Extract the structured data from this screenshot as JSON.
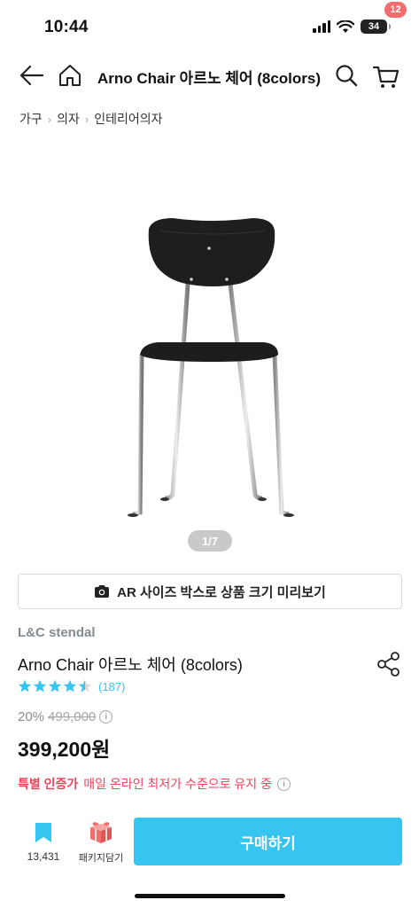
{
  "status_bar": {
    "time": "10:44",
    "battery": "34"
  },
  "header": {
    "title": "Arno Chair 아르노 체어 (8colors)",
    "cart_count": "12"
  },
  "breadcrumb": [
    "가구",
    "의자",
    "인테리어의자"
  ],
  "image": {
    "pager": "1/7"
  },
  "ar_button": {
    "label": "AR 사이즈 박스로 상품 크기 미리보기"
  },
  "product": {
    "brand": "L&C stendal",
    "name": "Arno Chair 아르노 체어 (8colors)",
    "rating_stars": 4.5,
    "review_count": "(187)",
    "discount": "20%",
    "original_price": "499,000",
    "price": "399,200원",
    "special_label": "특별 인증가",
    "special_text": "매일 온라인 최저가 수준으로 유지 중"
  },
  "bottom_bar": {
    "bookmark_count": "13,431",
    "package_label": "패키지담기",
    "buy_label": "구매하기"
  },
  "colors": {
    "accent": "#35c5f0",
    "badge": "#f26d6d",
    "special": "#f0435a"
  }
}
